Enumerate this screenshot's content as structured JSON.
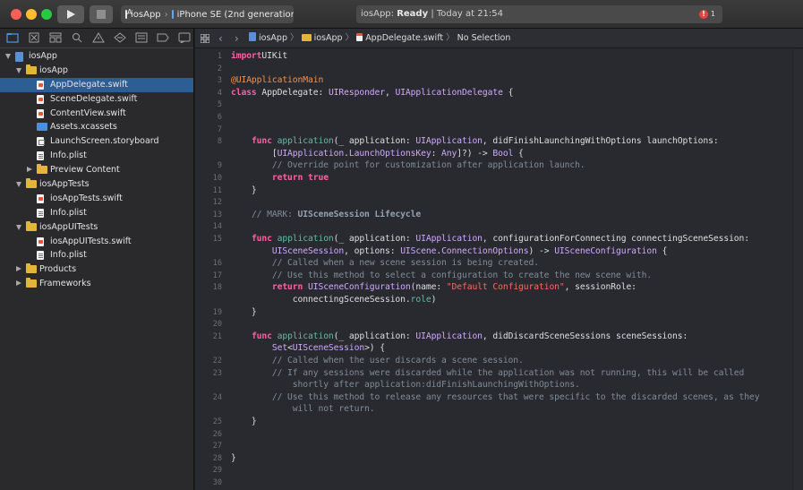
{
  "toolbar": {
    "scheme_app": "iosApp",
    "scheme_device": "iPhone SE (2nd generation)",
    "status_app": "iosApp:",
    "status_state": "Ready",
    "status_time": "| Today at 21:54",
    "error_count": "1"
  },
  "navigator": {
    "tabs": [
      "folder-icon",
      "source-control-icon",
      "symbol-icon",
      "find-icon",
      "issue-icon",
      "test-icon",
      "debug-icon",
      "breakpoint-icon",
      "report-icon"
    ],
    "tree": [
      {
        "label": "iosApp",
        "depth": 0,
        "kind": "project",
        "disclosure": "open"
      },
      {
        "label": "iosApp",
        "depth": 1,
        "kind": "folder",
        "disclosure": "open"
      },
      {
        "label": "AppDelegate.swift",
        "depth": 2,
        "kind": "swift",
        "selected": true
      },
      {
        "label": "SceneDelegate.swift",
        "depth": 2,
        "kind": "swift"
      },
      {
        "label": "ContentView.swift",
        "depth": 2,
        "kind": "swift"
      },
      {
        "label": "Assets.xcassets",
        "depth": 2,
        "kind": "assets"
      },
      {
        "label": "LaunchScreen.storyboard",
        "depth": 2,
        "kind": "storyboard"
      },
      {
        "label": "Info.plist",
        "depth": 2,
        "kind": "plist"
      },
      {
        "label": "Preview Content",
        "depth": 2,
        "kind": "folder",
        "disclosure": "closed"
      },
      {
        "label": "iosAppTests",
        "depth": 1,
        "kind": "folder",
        "disclosure": "open"
      },
      {
        "label": "iosAppTests.swift",
        "depth": 2,
        "kind": "swift"
      },
      {
        "label": "Info.plist",
        "depth": 2,
        "kind": "plist"
      },
      {
        "label": "iosAppUITests",
        "depth": 1,
        "kind": "folder",
        "disclosure": "open"
      },
      {
        "label": "iosAppUITests.swift",
        "depth": 2,
        "kind": "swift"
      },
      {
        "label": "Info.plist",
        "depth": 2,
        "kind": "plist"
      },
      {
        "label": "Products",
        "depth": 1,
        "kind": "folder",
        "disclosure": "closed"
      },
      {
        "label": "Frameworks",
        "depth": 1,
        "kind": "folder",
        "disclosure": "closed"
      }
    ]
  },
  "editor": {
    "breadcrumb": [
      "iosApp",
      "iosApp",
      "AppDelegate.swift",
      "No Selection"
    ],
    "lines": [
      {
        "n": "1",
        "code": [
          [
            "kw",
            "import"
          ],
          [
            "",
            "UIKit"
          ]
        ]
      },
      {
        "n": "2",
        "code": []
      },
      {
        "n": "3",
        "code": [
          [
            "attr",
            "@UIApplicationMain"
          ]
        ]
      },
      {
        "n": "4",
        "code": [
          [
            "kw",
            "class"
          ],
          [
            "",
            " AppDelegate: "
          ],
          [
            "ty",
            "UIResponder"
          ],
          [
            "",
            ", "
          ],
          [
            "ty",
            "UIApplicationDelegate"
          ],
          [
            "",
            " {"
          ]
        ]
      },
      {
        "n": "5",
        "code": []
      },
      {
        "n": "6",
        "code": []
      },
      {
        "n": "7",
        "code": []
      },
      {
        "n": "8",
        "code": [
          [
            "",
            "    "
          ],
          [
            "kw",
            "func"
          ],
          [
            "",
            " "
          ],
          [
            "fn",
            "application"
          ],
          [
            "",
            "(_ application: "
          ],
          [
            "ty",
            "UIApplication"
          ],
          [
            "",
            ", didFinishLaunchingWithOptions launchOptions:"
          ]
        ]
      },
      {
        "n": "",
        "code": [
          [
            "",
            "        ["
          ],
          [
            "ty",
            "UIApplication"
          ],
          [
            "",
            "."
          ],
          [
            "ty",
            "LaunchOptionsKey"
          ],
          [
            "",
            ": "
          ],
          [
            "ty",
            "Any"
          ],
          [
            "",
            "]?) -> "
          ],
          [
            "ty",
            "Bool"
          ],
          [
            "",
            " {"
          ]
        ]
      },
      {
        "n": "9",
        "code": [
          [
            "",
            "        "
          ],
          [
            "cm",
            "// Override point for customization after application launch."
          ]
        ]
      },
      {
        "n": "10",
        "code": [
          [
            "",
            "        "
          ],
          [
            "kw",
            "return"
          ],
          [
            "",
            " "
          ],
          [
            "kw",
            "true"
          ]
        ]
      },
      {
        "n": "11",
        "code": [
          [
            "",
            "    }"
          ]
        ]
      },
      {
        "n": "12",
        "code": []
      },
      {
        "n": "13",
        "code": [
          [
            "",
            "    "
          ],
          [
            "cm",
            "// MARK: "
          ],
          [
            "mark",
            "UISceneSession Lifecycle"
          ]
        ]
      },
      {
        "n": "14",
        "code": []
      },
      {
        "n": "15",
        "code": [
          [
            "",
            "    "
          ],
          [
            "kw",
            "func"
          ],
          [
            "",
            " "
          ],
          [
            "fn",
            "application"
          ],
          [
            "",
            "(_ application: "
          ],
          [
            "ty",
            "UIApplication"
          ],
          [
            "",
            ", configurationForConnecting connectingSceneSession:"
          ]
        ]
      },
      {
        "n": "",
        "code": [
          [
            "",
            "        "
          ],
          [
            "ty",
            "UISceneSession"
          ],
          [
            "",
            ", options: "
          ],
          [
            "ty",
            "UIScene"
          ],
          [
            "",
            "."
          ],
          [
            "ty",
            "ConnectionOptions"
          ],
          [
            "",
            ") -> "
          ],
          [
            "ty",
            "UISceneConfiguration"
          ],
          [
            "",
            " {"
          ]
        ]
      },
      {
        "n": "16",
        "code": [
          [
            "",
            "        "
          ],
          [
            "cm",
            "// Called when a new scene session is being created."
          ]
        ]
      },
      {
        "n": "17",
        "code": [
          [
            "",
            "        "
          ],
          [
            "cm",
            "// Use this method to select a configuration to create the new scene with."
          ]
        ]
      },
      {
        "n": "18",
        "code": [
          [
            "",
            "        "
          ],
          [
            "kw",
            "return"
          ],
          [
            "",
            " "
          ],
          [
            "ty",
            "UISceneConfiguration"
          ],
          [
            "",
            "(name: "
          ],
          [
            "str",
            "\"Default Configuration\""
          ],
          [
            "",
            ", sessionRole:"
          ]
        ]
      },
      {
        "n": "",
        "code": [
          [
            "",
            "            connectingSceneSession."
          ],
          [
            "fn",
            "role"
          ],
          [
            "",
            ")"
          ]
        ]
      },
      {
        "n": "19",
        "code": [
          [
            "",
            "    }"
          ]
        ]
      },
      {
        "n": "20",
        "code": []
      },
      {
        "n": "21",
        "code": [
          [
            "",
            "    "
          ],
          [
            "kw",
            "func"
          ],
          [
            "",
            " "
          ],
          [
            "fn",
            "application"
          ],
          [
            "",
            "(_ application: "
          ],
          [
            "ty",
            "UIApplication"
          ],
          [
            "",
            ", didDiscardSceneSessions sceneSessions:"
          ]
        ]
      },
      {
        "n": "",
        "code": [
          [
            "",
            "        "
          ],
          [
            "ty",
            "Set"
          ],
          [
            "",
            "<"
          ],
          [
            "ty",
            "UISceneSession"
          ],
          [
            "",
            ">) {"
          ]
        ]
      },
      {
        "n": "22",
        "code": [
          [
            "",
            "        "
          ],
          [
            "cm",
            "// Called when the user discards a scene session."
          ]
        ]
      },
      {
        "n": "23",
        "code": [
          [
            "",
            "        "
          ],
          [
            "cm",
            "// If any sessions were discarded while the application was not running, this will be called"
          ]
        ]
      },
      {
        "n": "",
        "code": [
          [
            "",
            "            "
          ],
          [
            "cm",
            "shortly after application:didFinishLaunchingWithOptions."
          ]
        ]
      },
      {
        "n": "24",
        "code": [
          [
            "",
            "        "
          ],
          [
            "cm",
            "// Use this method to release any resources that were specific to the discarded scenes, as they"
          ]
        ]
      },
      {
        "n": "",
        "code": [
          [
            "",
            "            "
          ],
          [
            "cm",
            "will not return."
          ]
        ]
      },
      {
        "n": "25",
        "code": [
          [
            "",
            "    }"
          ]
        ]
      },
      {
        "n": "26",
        "code": []
      },
      {
        "n": "27",
        "code": []
      },
      {
        "n": "28",
        "code": [
          [
            "",
            "}"
          ]
        ]
      },
      {
        "n": "29",
        "code": []
      },
      {
        "n": "30",
        "code": []
      }
    ]
  }
}
